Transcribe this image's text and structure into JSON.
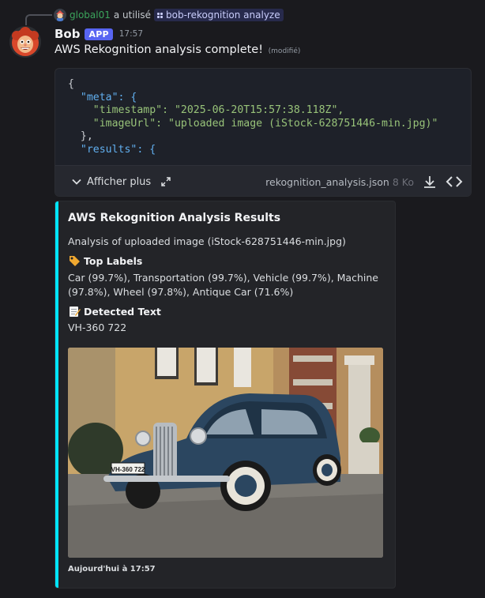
{
  "reply": {
    "user": "global01",
    "verb": "a utilisé",
    "command": "bob-rekognition analyze"
  },
  "message": {
    "username": "Bob",
    "badge": "APP",
    "timestamp": "17:57",
    "text": "AWS Rekognition analysis complete!",
    "edited": "(modifié)"
  },
  "attachment": {
    "code_lines": [
      "{",
      "  \"meta\": {",
      "    \"timestamp\": \"2025-06-20T15:57:38.118Z\",",
      "    \"imageUrl\": \"uploaded image (iStock-628751446-min.jpg)\"",
      "  },",
      "  \"results\": {"
    ],
    "show_more": "Afficher plus",
    "filename": "rekognition_analysis.json",
    "size": "8 Ko"
  },
  "embed": {
    "accent": "#00e5ff",
    "title": "AWS Rekognition Analysis Results",
    "description": "Analysis of uploaded image (iStock-628751446-min.jpg)",
    "fields": [
      {
        "emoji": "label-tag-icon",
        "name": "Top Labels",
        "value": "Car (99.7%), Transportation (99.7%), Vehicle (99.7%), Machine (97.8%), Wheel (97.8%), Antique Car (71.6%)"
      },
      {
        "emoji": "memo-icon",
        "name": "Detected Text",
        "value": "VH-360 722"
      }
    ],
    "plate_text": "VH-360 722",
    "footer": "Aujourd'hui à 17:57"
  }
}
